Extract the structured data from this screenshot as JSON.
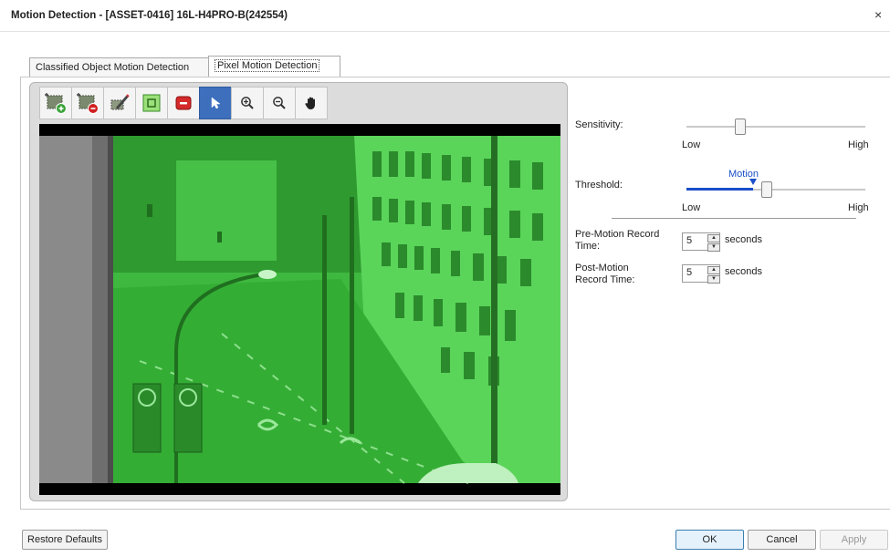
{
  "window": {
    "title": "Motion Detection - [ASSET-0416] 16L-H4PRO-B(242554)",
    "close_glyph": "×"
  },
  "tabs": [
    {
      "label": "Classified Object Motion Detection"
    },
    {
      "label": "Pixel Motion Detection",
      "selected": true
    }
  ],
  "toolbar": {
    "tools": [
      {
        "name": "add-region-icon"
      },
      {
        "name": "remove-region-icon"
      },
      {
        "name": "draw-mask-icon"
      },
      {
        "name": "fill-all-icon"
      },
      {
        "name": "clear-all-icon"
      },
      {
        "name": "pointer-icon",
        "active": true
      },
      {
        "name": "zoom-in-icon"
      },
      {
        "name": "zoom-out-icon"
      },
      {
        "name": "pan-hand-icon"
      }
    ]
  },
  "settings": {
    "sensitivity": {
      "label": "Sensitivity:",
      "low": "Low",
      "high": "High",
      "value": 0.3
    },
    "threshold": {
      "label": "Threshold:",
      "motion_label": "Motion",
      "low": "Low",
      "high": "High",
      "value": 0.45,
      "motion_level": 0.37
    },
    "pre_motion": {
      "label_line1": "Pre-Motion Record",
      "label_line2": "Time:",
      "value": "5",
      "unit": "seconds"
    },
    "post_motion": {
      "label_line1": "Post-Motion",
      "label_line2": "Record Time:",
      "value": "5",
      "unit": "seconds"
    }
  },
  "buttons": {
    "restore": "Restore Defaults",
    "ok": "OK",
    "cancel": "Cancel",
    "apply": "Apply"
  },
  "colors": {
    "overlay": "#33cc33",
    "accent": "#3d6fbd",
    "motion": "#1a4fc8"
  }
}
